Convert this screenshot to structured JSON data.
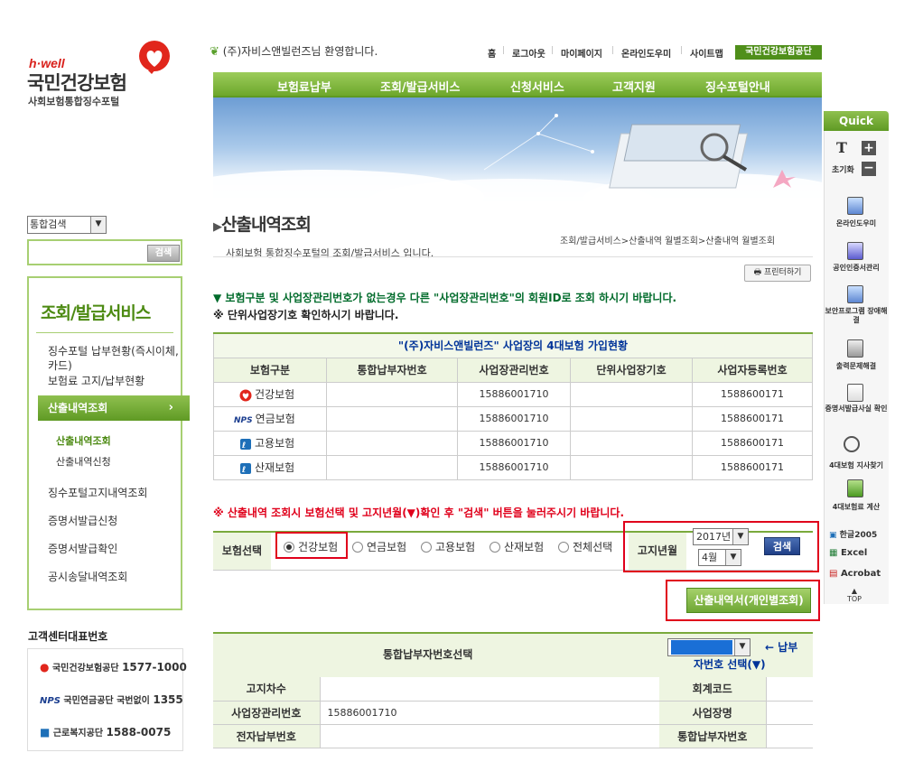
{
  "header": {
    "logo_hwell": "h·well",
    "logo_main": "국민건강보험",
    "logo_sub": "사회보험통합징수포털",
    "welcome_company": "(주)자비스앤빌런즈",
    "welcome_suffix": "님 환영합니다.",
    "top_links": [
      "홈",
      "로그아웃",
      "마이페이지",
      "온라인도우미",
      "사이트맵"
    ],
    "top_link_nhis": "국민건강보험공단"
  },
  "menu": {
    "items": [
      "보험료납부",
      "조회/발급서비스",
      "신청서비스",
      "고객지원",
      "징수포털안내"
    ]
  },
  "page": {
    "title": "산출내역조회",
    "subtitle": "사회보험 통합징수포털의 조회/발급서비스 입니다.",
    "breadcrumb": "조회/발급서비스>산출내역 월별조회>산출내역 월별조회",
    "print_label": "프린터하기",
    "notice1": "▼ 보험구분 및 사업장관리번호가 없는경우 다른 \"사업장관리번호\"의 회원ID로 조회 하시기 바랍니다.",
    "notice2": "※ 단위사업장기호 확인하시기 바랍니다.",
    "notice3": "※ 산출내역 조회시 보험선택 및 고지년월(▼)확인 후 \"검색\" 버튼을 눌러주시기 바랍니다."
  },
  "insurance_table": {
    "caption_company": "\"(주)자비스앤빌런즈\"",
    "caption_suffix": "사업장의 4대보험 가입현황",
    "headers": [
      "보험구분",
      "통합납부자번호",
      "사업장관리번호",
      "단위사업장기호",
      "사업자등록번호"
    ],
    "rows": [
      {
        "name": "건강보험",
        "pay_no": "",
        "mgmt_no": "15886001710",
        "unit": "",
        "biz_no": "1588600171"
      },
      {
        "name": "연금보험",
        "pay_no": "",
        "mgmt_no": "15886001710",
        "unit": "",
        "biz_no": "1588600171"
      },
      {
        "name": "고용보험",
        "pay_no": "",
        "mgmt_no": "15886001710",
        "unit": "",
        "biz_no": "1588600171"
      },
      {
        "name": "산재보험",
        "pay_no": "",
        "mgmt_no": "15886001710",
        "unit": "",
        "biz_no": "1588600171"
      }
    ],
    "nps_text": "NPS"
  },
  "search": {
    "label": "보험선택",
    "options": [
      "건강보험",
      "연금보험",
      "고용보험",
      "산재보험",
      "전체선택"
    ],
    "selected": "건강보험",
    "period_label": "고지년월",
    "year": "2017년",
    "month": "4월",
    "search_button": "검색",
    "calc_button": "산출내역서(개인별조회)"
  },
  "bottom_table": {
    "title": "통합납부자번호선택",
    "hint_line1": "← 납부",
    "hint_line2": "자번호 선택(▼)",
    "rows": [
      {
        "l1": "고지차수",
        "v1": "",
        "l2": "회계코드",
        "v2": ""
      },
      {
        "l1": "사업장관리번호",
        "v1": "15886001710",
        "l2": "사업장명",
        "v2": ""
      },
      {
        "l1": "전자납부번호",
        "v1": "",
        "l2": "통합납부자번호",
        "v2": ""
      }
    ]
  },
  "sidebar": {
    "select_value": "통합검색",
    "search_button": "검색",
    "menu_title": "조회/발급서비스",
    "items": [
      "징수포털 납부현황(즉시이체,카드)",
      "보험료 고지/납부현황",
      "산출내역조회",
      "징수포털고지내역조회",
      "증명서발급신청",
      "증명서발급확인",
      "공시송달내역조회"
    ],
    "sub_items": [
      "산출내역조회",
      "산출내역신청"
    ],
    "customer_center": "고객센터대표번호",
    "cc_lines": [
      {
        "org": "국민건강보험공단",
        "num": "1577-1000"
      },
      {
        "org": "국민연금공단 국번없이",
        "num": "1355"
      },
      {
        "org": "근로복지공단",
        "num": "1588-0075"
      }
    ]
  },
  "quick": {
    "title": "Quick",
    "font_label": "T",
    "reset_label": "초기화",
    "items": [
      "온라인도우미",
      "공인인증서관리",
      "보안프로그램 장애해결",
      "출력문제해결",
      "증명서발급사실 확인",
      "4대보험 지사찾기",
      "4대보험료 계산"
    ],
    "apps": [
      "한글2005",
      "Excel",
      "Acrobat"
    ],
    "top": "TOP"
  },
  "colors": {
    "accent_green": "#6da72c",
    "highlight_red": "#e0001b",
    "navy": "#003399"
  }
}
